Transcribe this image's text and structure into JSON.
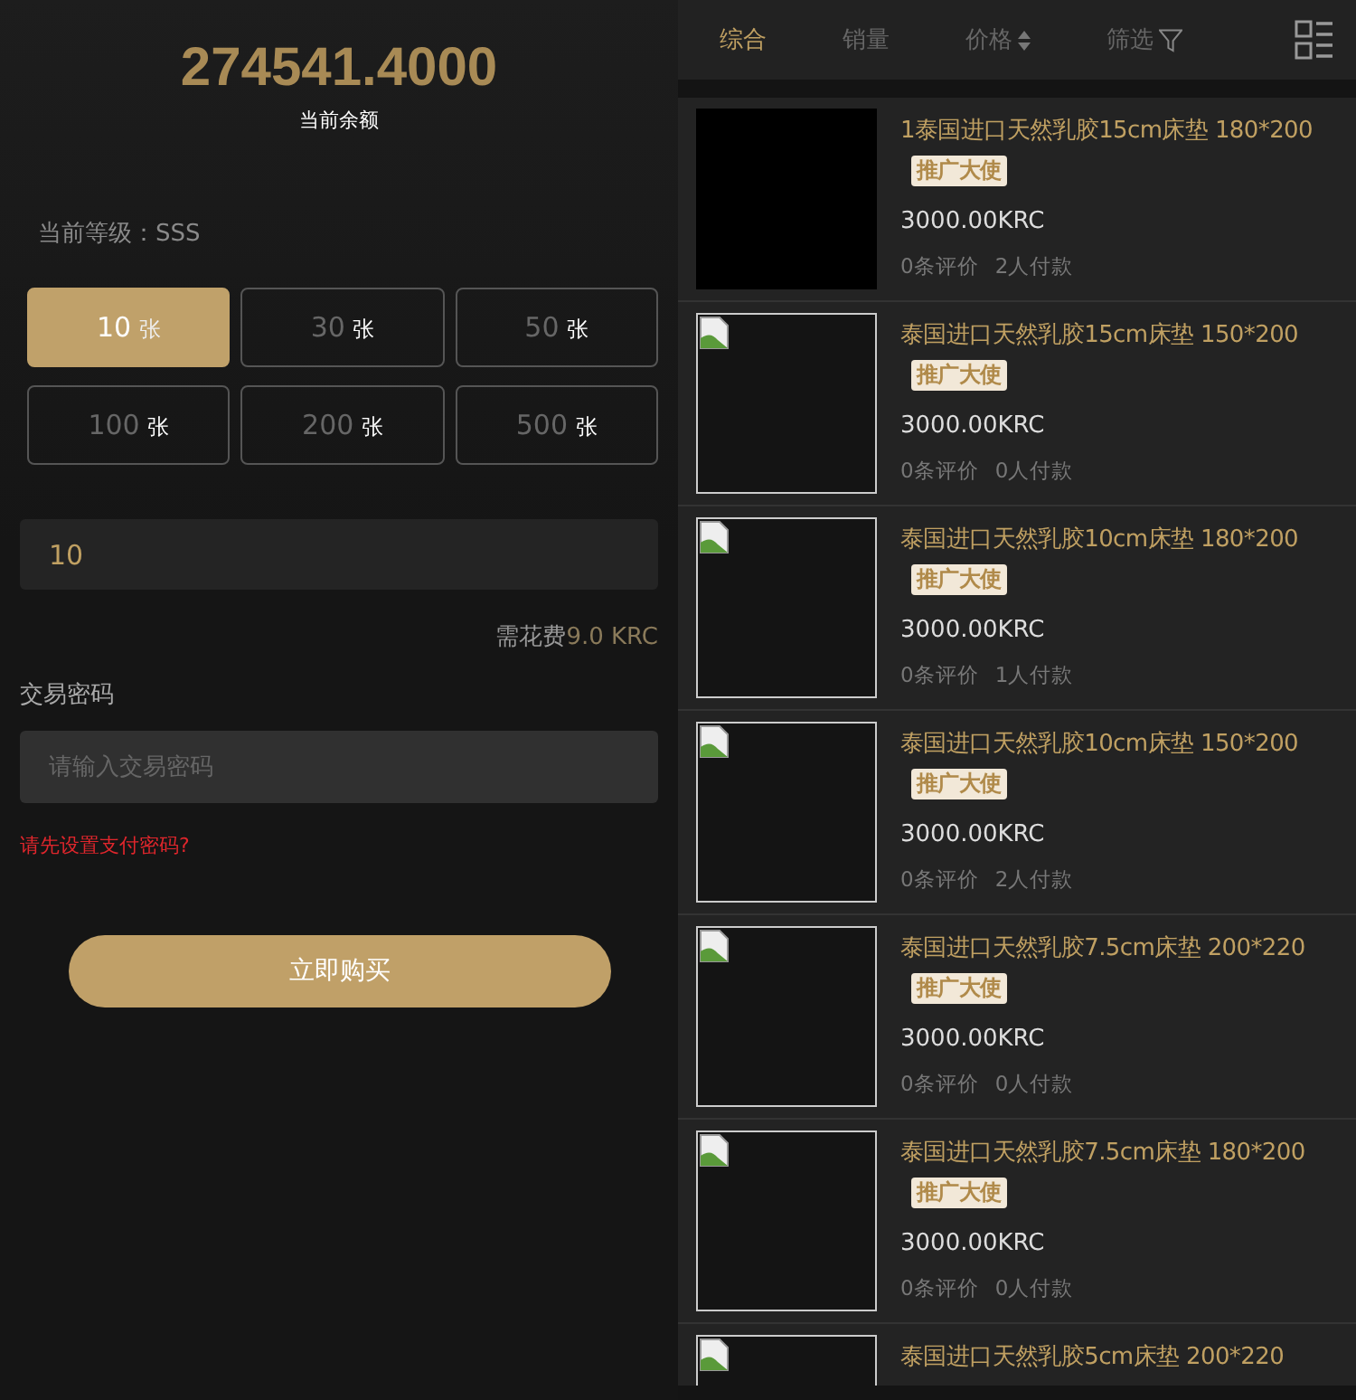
{
  "balance": {
    "amount": "274541.4000",
    "label": "当前余额"
  },
  "level": "当前等级：SSS",
  "quantities": [
    {
      "number": "10",
      "unit": "张",
      "selected": true
    },
    {
      "number": "30",
      "unit": "张",
      "selected": false
    },
    {
      "number": "50",
      "unit": "张",
      "selected": false
    },
    {
      "number": "100",
      "unit": "张",
      "selected": false
    },
    {
      "number": "200",
      "unit": "张",
      "selected": false
    },
    {
      "number": "500",
      "unit": "张",
      "selected": false
    }
  ],
  "quantity_field": {
    "value": "10"
  },
  "fee": {
    "label": "需花费",
    "amount": "9.0 KRC"
  },
  "password": {
    "label": "交易密码",
    "placeholder": "请输入交易密码"
  },
  "warning": "请先设置支付密码?",
  "buy_button": "立即购买",
  "sort_tabs": [
    {
      "label": "综合",
      "kind": "plain",
      "selected": true
    },
    {
      "label": "销量",
      "kind": "plain",
      "selected": false
    },
    {
      "label": "价格",
      "kind": "sort",
      "selected": false
    },
    {
      "label": "筛选",
      "kind": "filter",
      "selected": false
    }
  ],
  "products": [
    {
      "kind": "blank",
      "title": "1泰国进口天然乳胶15cm床垫 180*200",
      "badge": "推广大使",
      "price": "3000.00KRC",
      "reviews": "0条评价",
      "payments": "2人付款"
    },
    {
      "kind": "broken",
      "title": "泰国进口天然乳胶15cm床垫 150*200",
      "badge": "推广大使",
      "price": "3000.00KRC",
      "reviews": "0条评价",
      "payments": "0人付款"
    },
    {
      "kind": "broken",
      "title": "泰国进口天然乳胶10cm床垫 180*200",
      "badge": "推广大使",
      "price": "3000.00KRC",
      "reviews": "0条评价",
      "payments": "1人付款"
    },
    {
      "kind": "broken",
      "title": "泰国进口天然乳胶10cm床垫 150*200",
      "badge": "推广大使",
      "price": "3000.00KRC",
      "reviews": "0条评价",
      "payments": "2人付款"
    },
    {
      "kind": "broken",
      "title": "泰国进口天然乳胶7.5cm床垫 200*220",
      "badge": "推广大使",
      "price": "3000.00KRC",
      "reviews": "0条评价",
      "payments": "0人付款"
    },
    {
      "kind": "broken",
      "title": "泰国进口天然乳胶7.5cm床垫 180*200",
      "badge": "推广大使",
      "price": "3000.00KRC",
      "reviews": "0条评价",
      "payments": "0人付款"
    },
    {
      "kind": "broken",
      "title": "泰国进口天然乳胶5cm床垫 200*220"
    }
  ]
}
